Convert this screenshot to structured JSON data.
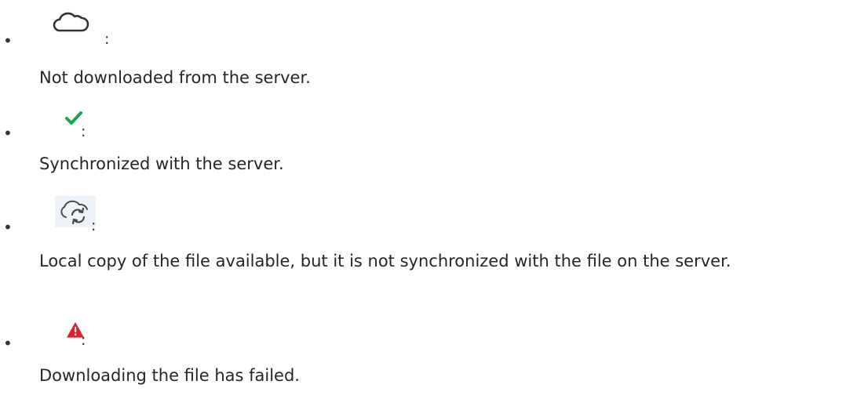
{
  "status_icons": {
    "items": [
      {
        "icon": "cloud-icon",
        "separator": ":",
        "description": "Not downloaded from the server."
      },
      {
        "icon": "check-icon",
        "icon_color": "#1aa64a",
        "separator": ":",
        "description": "Synchronized with the server."
      },
      {
        "icon": "cloud-sync-icon",
        "separator": ":",
        "description": "Local copy of the file available, but it is not synchronized with the file on the server."
      },
      {
        "icon": "warning-icon",
        "icon_color": "#e0202c",
        "separator": ":",
        "description": "Downloading the file has failed."
      }
    ]
  }
}
